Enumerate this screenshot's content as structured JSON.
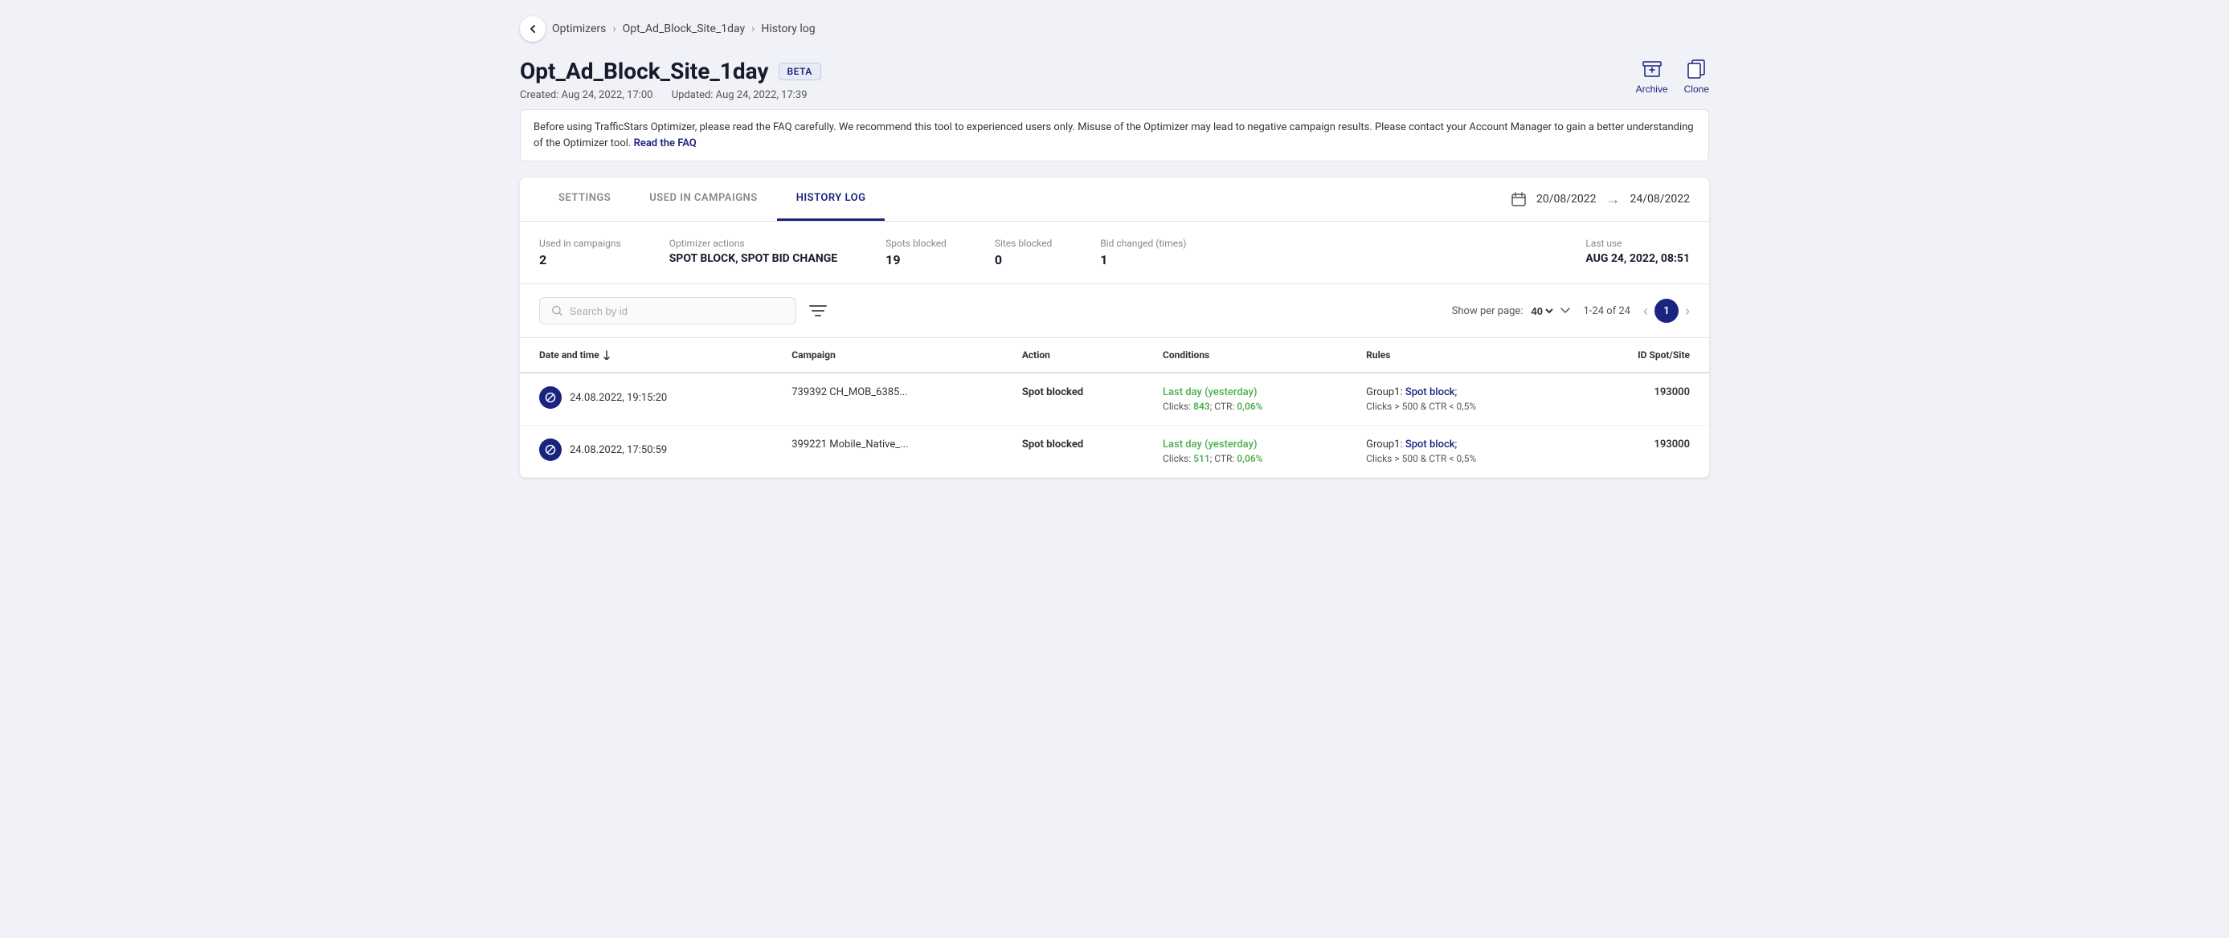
{
  "breadcrumb": {
    "back_label": "←",
    "items": [
      "Optimizers",
      "Opt_Ad_Block_Site_1day",
      "History log"
    ]
  },
  "header": {
    "title": "Opt_Ad_Block_Site_1day",
    "beta_label": "BETA",
    "created": "Created: Aug 24, 2022, 17:00",
    "updated": "Updated: Aug 24, 2022, 17:39",
    "archive_label": "Archive",
    "clone_label": "Clone"
  },
  "warning": {
    "text": "Before using TrafficStars Optimizer, please read the FAQ carefully. We recommend this tool to experienced users only. Misuse of the Optimizer may lead to negative campaign results.\nPlease contact your Account Manager to gain a better understanding of the Optimizer tool.",
    "link_text": "Read the FAQ"
  },
  "tabs": [
    {
      "id": "settings",
      "label": "SETTINGS"
    },
    {
      "id": "used_in_campaigns",
      "label": "USED IN CAMPAIGNS"
    },
    {
      "id": "history_log",
      "label": "HISTORY LOG",
      "active": true
    }
  ],
  "date_range": {
    "from": "20/08/2022",
    "to": "24/08/2022"
  },
  "stats": [
    {
      "label": "Used in campaigns",
      "value": "2"
    },
    {
      "label": "Optimizer actions",
      "value": "SPOT BLOCK, SPOT BID CHANGE"
    },
    {
      "label": "Spots blocked",
      "value": "19"
    },
    {
      "label": "Sites blocked",
      "value": "0"
    },
    {
      "label": "Bid changed (times)",
      "value": "1"
    },
    {
      "label": "Last use",
      "value": "AUG 24, 2022, 08:51"
    }
  ],
  "search": {
    "placeholder": "Search by id",
    "filter_icon": "≡"
  },
  "pagination": {
    "show_per_page_label": "Show per page:",
    "per_page_value": "40",
    "range_label": "1-24 of 24",
    "current_page": "1"
  },
  "table": {
    "columns": [
      {
        "id": "datetime",
        "label": "Date and time",
        "sortable": true
      },
      {
        "id": "campaign",
        "label": "Campaign"
      },
      {
        "id": "action",
        "label": "Action"
      },
      {
        "id": "conditions",
        "label": "Conditions"
      },
      {
        "id": "rules",
        "label": "Rules"
      },
      {
        "id": "id_spot_site",
        "label": "ID Spot/Site"
      }
    ],
    "rows": [
      {
        "datetime": "24.08.2022, 19:15:20",
        "campaign": "739392 CH_MOB_6385...",
        "action": "Spot blocked",
        "cond_period": "Last day (yesterday)",
        "cond_detail": "Clicks: 843; CTR: 0,06%",
        "cond_clicks_val": "843",
        "cond_ctr_val": "0,06%",
        "rules_group": "Group1: Spot block;",
        "rules_detail": "Clicks > 500 & CTR < 0,5%",
        "rules_link_text": "Spot block",
        "id_spot_site": "193000"
      },
      {
        "datetime": "24.08.2022, 17:50:59",
        "campaign": "399221 Mobile_Native_...",
        "action": "Spot blocked",
        "cond_period": "Last day (yesterday)",
        "cond_detail": "Clicks: 511; CTR: 0,06%",
        "cond_clicks_val": "511",
        "cond_ctr_val": "0,06%",
        "rules_group": "Group1: Spot block;",
        "rules_detail": "Clicks > 500 & CTR < 0,5%",
        "rules_link_text": "Spot block",
        "id_spot_site": "193000"
      }
    ]
  },
  "colors": {
    "primary": "#1a237e",
    "green": "#4caf50",
    "light_blue": "#e8eaf6"
  }
}
